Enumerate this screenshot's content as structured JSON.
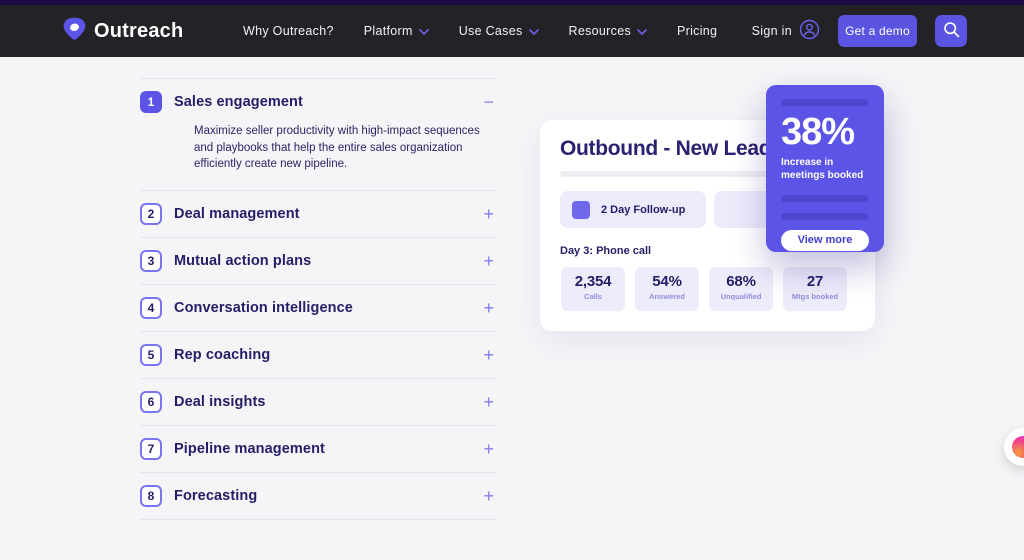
{
  "nav": {
    "brand": "Outreach",
    "links": [
      {
        "label": "Why Outreach?"
      },
      {
        "label": "Platform"
      },
      {
        "label": "Use Cases"
      },
      {
        "label": "Resources"
      },
      {
        "label": "Pricing"
      }
    ],
    "sign_in_label": "Sign in",
    "demo_button_label": "Get a demo"
  },
  "accordion": {
    "items": [
      {
        "number": "1",
        "label": "Sales engagement",
        "toggle_icon": "−",
        "description": "Maximize seller productivity with high-impact sequences and playbooks that help the entire sales organization efficiently create new pipeline."
      },
      {
        "number": "2",
        "label": "Deal management",
        "toggle_icon": "+"
      },
      {
        "number": "3",
        "label": "Mutual action plans",
        "toggle_icon": "+"
      },
      {
        "number": "4",
        "label": "Conversation intelligence",
        "toggle_icon": "+"
      },
      {
        "number": "5",
        "label": "Rep coaching",
        "toggle_icon": "+"
      },
      {
        "number": "6",
        "label": "Deal insights",
        "toggle_icon": "+"
      },
      {
        "number": "7",
        "label": "Pipeline management",
        "toggle_icon": "+"
      },
      {
        "number": "8",
        "label": "Forecasting",
        "toggle_icon": "+"
      }
    ]
  },
  "mockup": {
    "title": "Outbound - New Lead",
    "sequence_chip": "2 Day Follow-up",
    "day_label": "Day 3: Phone call",
    "stats": [
      {
        "value": "2,354",
        "label": "Calls"
      },
      {
        "value": "54%",
        "label": "Answered"
      },
      {
        "value": "68%",
        "label": "Unqualified"
      },
      {
        "value": "27",
        "label": "Mtgs booked"
      }
    ]
  },
  "overlay": {
    "stat": "38%",
    "caption": "Increase in meetings booked",
    "button_label": "View more"
  },
  "colors": {
    "accent": "#5b54e6",
    "dark_navy": "#241e66",
    "nav_bg": "#232226",
    "top_strip": "#1d0b47",
    "page_bg": "#f5f4f7"
  }
}
